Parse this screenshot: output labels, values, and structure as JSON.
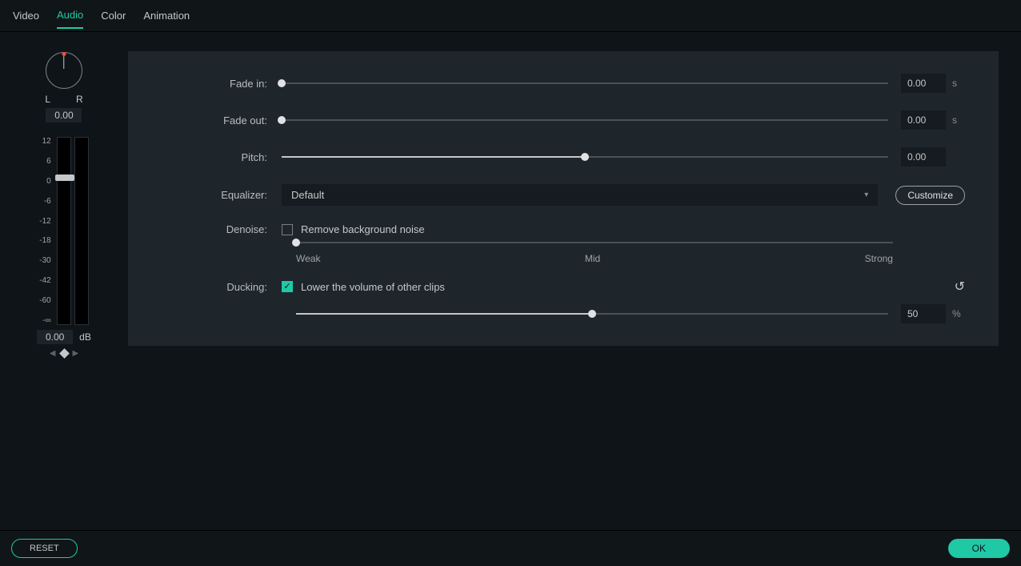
{
  "tabs": {
    "items": [
      "Video",
      "Audio",
      "Color",
      "Animation"
    ],
    "active_index": 1
  },
  "pan": {
    "l": "L",
    "r": "R",
    "value": "0.00"
  },
  "meter": {
    "ticks": [
      "12",
      "6",
      "0",
      "-6",
      "-12",
      "-18",
      "-30",
      "-42",
      "-60",
      "-∞"
    ],
    "gain": "0.00",
    "unit": "dB"
  },
  "fields": {
    "fade_in": {
      "label": "Fade in:",
      "value": "0.00",
      "unit": "s",
      "pct": 0
    },
    "fade_out": {
      "label": "Fade out:",
      "value": "0.00",
      "unit": "s",
      "pct": 0
    },
    "pitch": {
      "label": "Pitch:",
      "value": "0.00",
      "pct": 50
    },
    "equalizer": {
      "label": "Equalizer:",
      "selected": "Default",
      "customize": "Customize"
    },
    "denoise": {
      "label": "Denoise:",
      "checkbox_label": "Remove background noise",
      "checked": false,
      "pct": 0,
      "range": {
        "low": "Weak",
        "mid": "Mid",
        "high": "Strong"
      }
    },
    "ducking": {
      "label": "Ducking:",
      "checkbox_label": "Lower the volume of other clips",
      "checked": true,
      "value": "50",
      "unit": "%",
      "pct": 50
    }
  },
  "footer": {
    "reset": "RESET",
    "ok": "OK"
  }
}
